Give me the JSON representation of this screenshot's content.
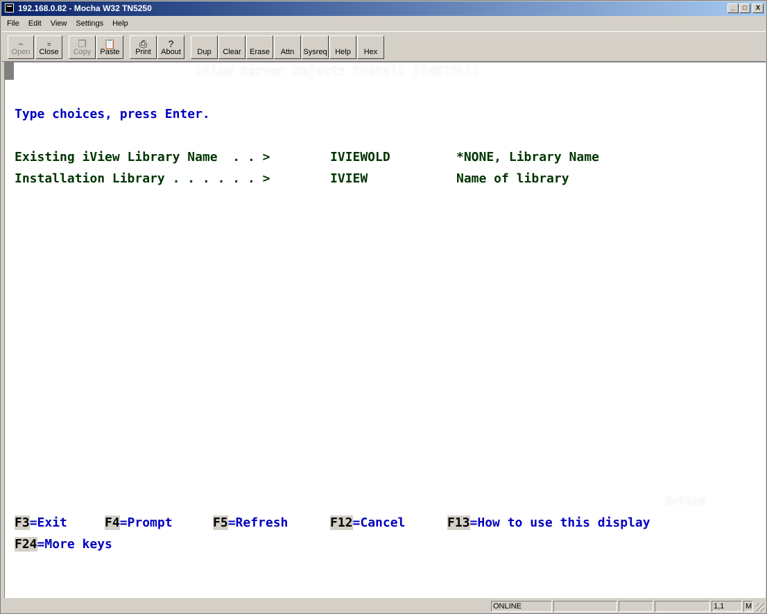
{
  "window": {
    "title": "192.168.0.82 - Mocha W32 TN5250",
    "controls": {
      "minimize": "_",
      "maximize": "□",
      "close": "X"
    }
  },
  "menu": [
    "File",
    "Edit",
    "View",
    "Settings",
    "Help"
  ],
  "toolbar": {
    "open": "Open",
    "close": "Close",
    "copy": "Copy",
    "paste": "Paste",
    "print": "Print",
    "about": "About",
    "dup": "Dup",
    "clear": "Clear",
    "erase": "Erase",
    "attn": "Attn",
    "sysreq": "Sysreq",
    "help": "Help",
    "hex": "Hex"
  },
  "screen": {
    "title": "iView Server Objects Install (INSTALL)",
    "instruction": "Type choices, press Enter.",
    "fields": [
      {
        "label": "Existing iView Library Name  . . >",
        "value": "IVIEWOLD",
        "hint": "*NONE, Library Name"
      },
      {
        "label": "Installation Library . . . . . . >",
        "value": "IVIEW",
        "hint": "Name of library"
      }
    ],
    "bottom_indicator": "Bottom",
    "fkeys_row1": [
      {
        "key": "F3",
        "text": "=Exit"
      },
      {
        "key": "F4",
        "text": "=Prompt"
      },
      {
        "key": "F5",
        "text": "=Refresh"
      },
      {
        "key": "F12",
        "text": "=Cancel"
      },
      {
        "key": "F13",
        "text": "=How to use this display"
      }
    ],
    "fkeys_row2": [
      {
        "key": "F24",
        "text": "=More keys"
      }
    ]
  },
  "status": {
    "connection": "ONLINE",
    "position": "1,1",
    "mode": "M"
  }
}
